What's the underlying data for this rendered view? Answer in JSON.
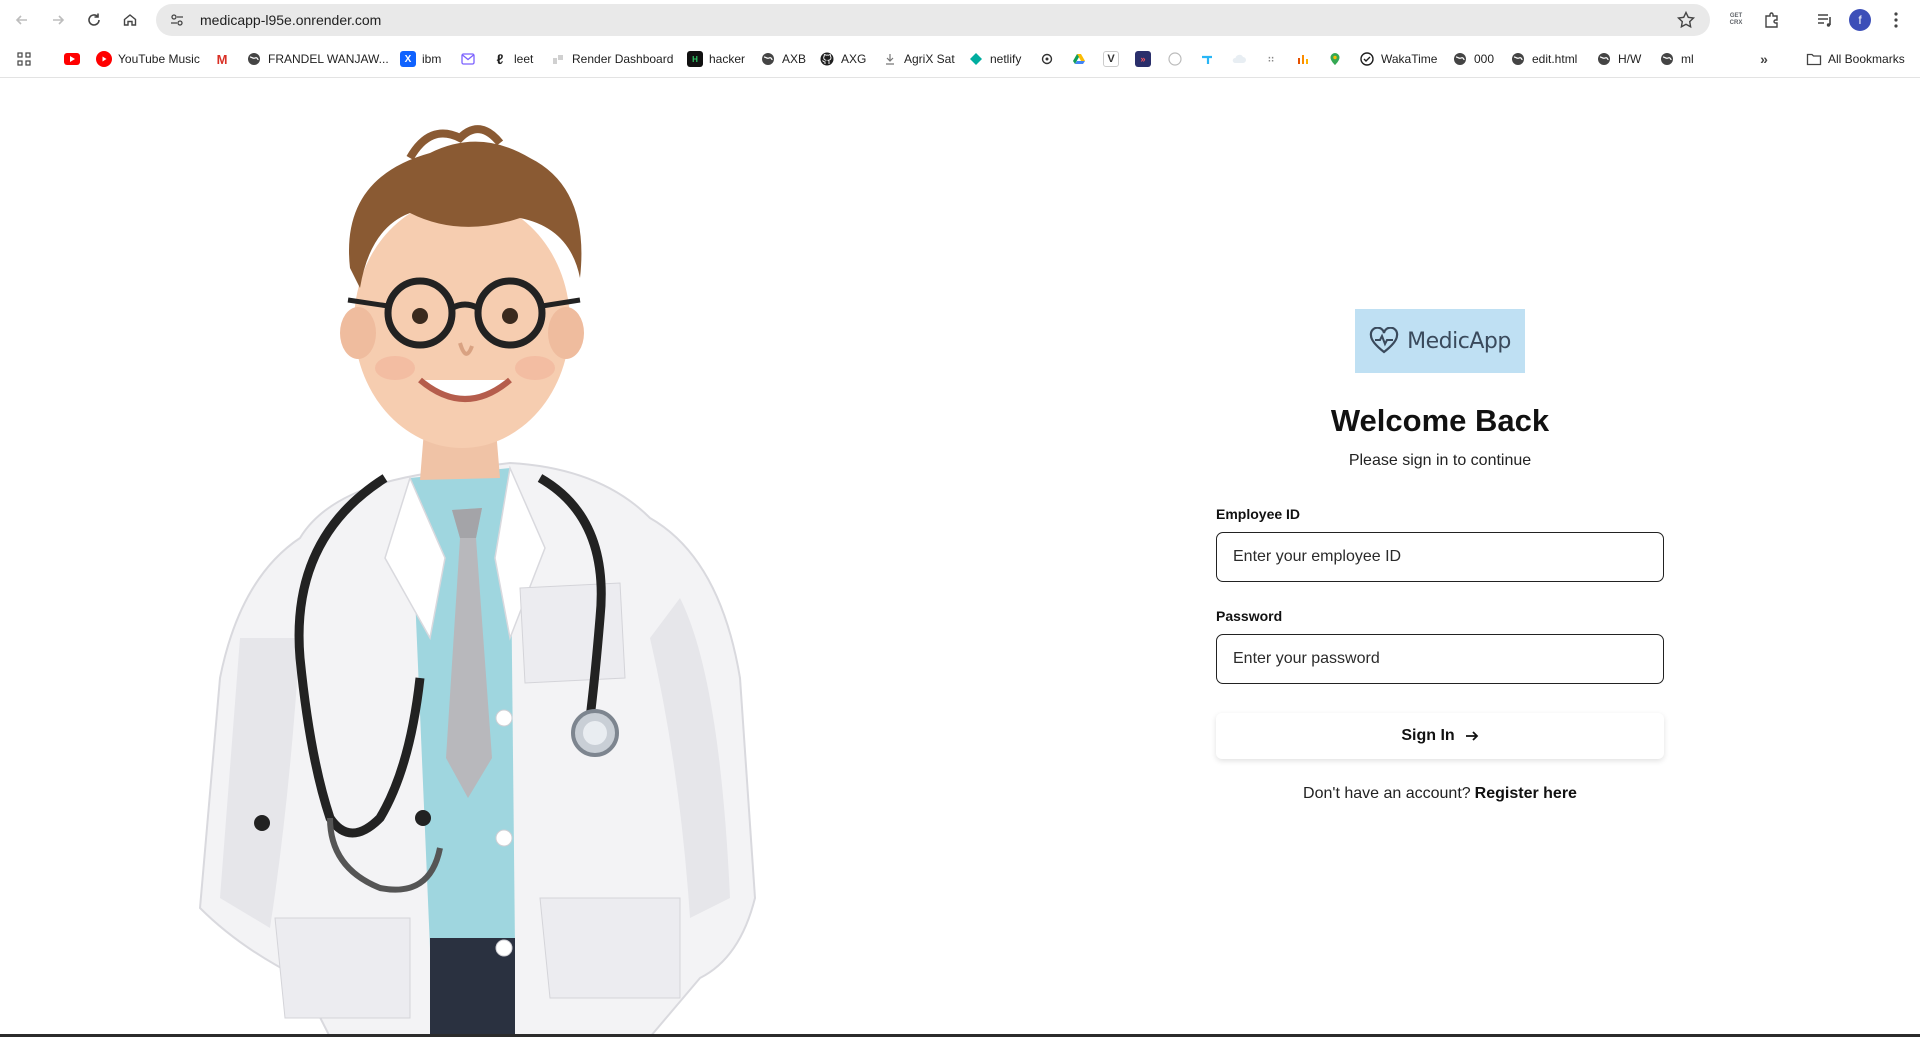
{
  "browser": {
    "url": "medicapp-l95e.onrender.com",
    "get_crx_top": "GET",
    "get_crx_bottom": "CRX",
    "profile_initial": "f",
    "bookmarks": [
      {
        "label": "",
        "icon": "youtube-icon",
        "color": "#ff0000"
      },
      {
        "label": "YouTube Music",
        "icon": "youtube-music-icon",
        "color": "#ff0000"
      },
      {
        "label": "",
        "icon": "gmail-icon",
        "color": "#d93025"
      },
      {
        "label": "FRANDEL WANJAW...",
        "icon": "globe-icon",
        "color": "#5f6368"
      },
      {
        "label": "ibm",
        "icon": "ibm-icon",
        "color": "#0f62fe"
      },
      {
        "label": "",
        "icon": "mail-icon",
        "color": "#7b61ff"
      },
      {
        "label": "leet",
        "icon": "leetcode-icon",
        "color": "#1f1f1f"
      },
      {
        "label": "Render Dashboard",
        "icon": "render-icon",
        "color": "#bdbdbd"
      },
      {
        "label": "hacker",
        "icon": "hackerrank-icon",
        "color": "#111111"
      },
      {
        "label": "AXB",
        "icon": "globe-icon",
        "color": "#5f6368"
      },
      {
        "label": "AXG",
        "icon": "github-icon",
        "color": "#1f1f1f"
      },
      {
        "label": "AgriX Sat",
        "icon": "agrix-icon",
        "color": "#5f6368"
      },
      {
        "label": "netlify",
        "icon": "netlify-icon",
        "color": "#00ad9f"
      },
      {
        "label": "All Bookmarks",
        "icon": "folder-icon",
        "color": "#5f6368"
      },
      {
        "label": "WakaTime",
        "icon": "wakatime-icon",
        "color": "#1f1f1f"
      },
      {
        "label": "000",
        "icon": "globe-icon",
        "color": "#5f6368"
      },
      {
        "label": "edit.html",
        "icon": "globe-icon",
        "color": "#5f6368"
      },
      {
        "label": "H/W",
        "icon": "globe-icon",
        "color": "#5f6368"
      },
      {
        "label": "ml",
        "icon": "globe-icon",
        "color": "#5f6368"
      }
    ]
  },
  "login": {
    "logo_text": "MedicApp",
    "title": "Welcome Back",
    "subtitle": "Please sign in to continue",
    "employee_id_label": "Employee ID",
    "employee_id_placeholder": "Enter your employee ID",
    "password_label": "Password",
    "password_placeholder": "Enter your password",
    "sign_in_label": "Sign In",
    "register_prompt": "Don't have an account?",
    "register_link": "Register here"
  },
  "colors": {
    "logo_bg": "#bfe0f3",
    "logo_text": "#3a4a5c",
    "heading": "#111111"
  }
}
